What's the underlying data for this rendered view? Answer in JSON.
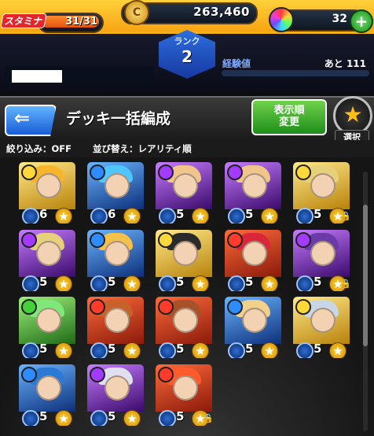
{
  "header": {
    "stamina_label": "スタミナ",
    "stamina_value": "31/31",
    "stamina_fraction": 1.0,
    "coins": "263,460",
    "gems": "32",
    "gem_plus": "+",
    "rank_label": "ランク",
    "rank_value": "2",
    "exp_label": "経験値",
    "exp_remaining": "あと 111"
  },
  "title_bar": {
    "back_arrow": "⇐",
    "title": "デッキ一括編成",
    "sort_button_line1": "表示順",
    "sort_button_line2": "変更",
    "select_label": "選択",
    "select_star": "★"
  },
  "filter_row": {
    "filter": "絞り込み：OFF",
    "sort": "並び替え：レアリティ順"
  },
  "colors": {
    "header_orange": "#f7a512",
    "rank_blue": "#2c6fe0",
    "sort_green": "#1e8e1a",
    "star_gold": "#ffd53a"
  },
  "cards": [
    {
      "element": "light",
      "rarity": "6",
      "locked": false,
      "hair": "#f7b52c"
    },
    {
      "element": "water",
      "rarity": "6",
      "locked": false,
      "hair": "#4fc6ff"
    },
    {
      "element": "dark",
      "rarity": "5",
      "locked": false,
      "hair": "#f0c48a"
    },
    {
      "element": "dark",
      "rarity": "5",
      "locked": false,
      "hair": "#f0c48a"
    },
    {
      "element": "light",
      "rarity": "5",
      "locked": true,
      "hair": "#e6d17a"
    },
    {
      "element": "dark",
      "rarity": "5",
      "locked": false,
      "hair": "#e6d17a"
    },
    {
      "element": "water",
      "rarity": "5",
      "locked": false,
      "hair": "#f4c24a"
    },
    {
      "element": "light",
      "rarity": "5",
      "locked": false,
      "hair": "#2a2a2a"
    },
    {
      "element": "fire",
      "rarity": "5",
      "locked": false,
      "hair": "#d9263a"
    },
    {
      "element": "dark",
      "rarity": "5",
      "locked": true,
      "hair": "#6a3aa8"
    },
    {
      "element": "wood",
      "rarity": "5",
      "locked": false,
      "hair": "#7ee87a"
    },
    {
      "element": "fire",
      "rarity": "5",
      "locked": false,
      "hair": "#c8612a"
    },
    {
      "element": "fire",
      "rarity": "5",
      "locked": false,
      "hair": "#a8522a"
    },
    {
      "element": "water",
      "rarity": "5",
      "locked": false,
      "hair": "#f0d08a"
    },
    {
      "element": "light",
      "rarity": "5",
      "locked": false,
      "hair": "#c9d6e6"
    },
    {
      "element": "water",
      "rarity": "5",
      "locked": false,
      "hair": "#2a7ad6"
    },
    {
      "element": "dark",
      "rarity": "5",
      "locked": false,
      "hair": "#e0e0f0"
    },
    {
      "element": "fire",
      "rarity": "5",
      "locked": true,
      "hair": "#ff5a2a"
    }
  ]
}
